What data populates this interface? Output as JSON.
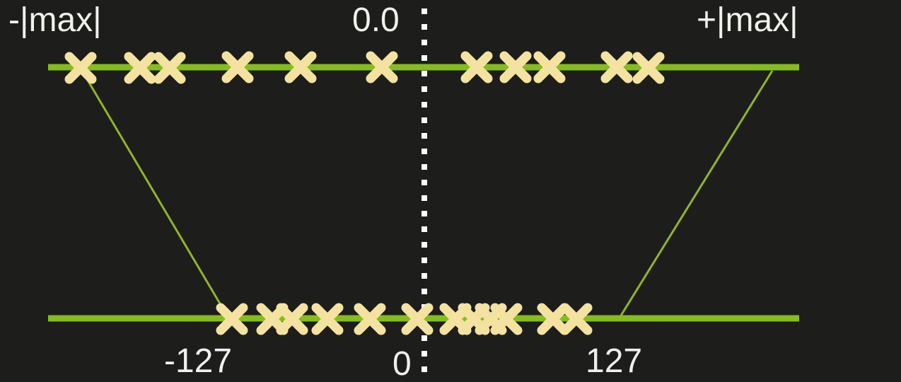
{
  "labels": {
    "neg_max": "-|max|",
    "zero_float": "0.0",
    "pos_max": "+|max|",
    "neg_127": "-127",
    "zero_int": "0",
    "pos_127": "127"
  },
  "colors": {
    "background": "#1d1d1b",
    "axis_line": "#84bd1e",
    "mapping_line": "#8fb52a",
    "marker": "#f4e2a0",
    "dotted_divider": "#ffffff",
    "text": "#f0f0ec"
  },
  "markers": {
    "top_count": 12,
    "bottom_count": 14
  }
}
